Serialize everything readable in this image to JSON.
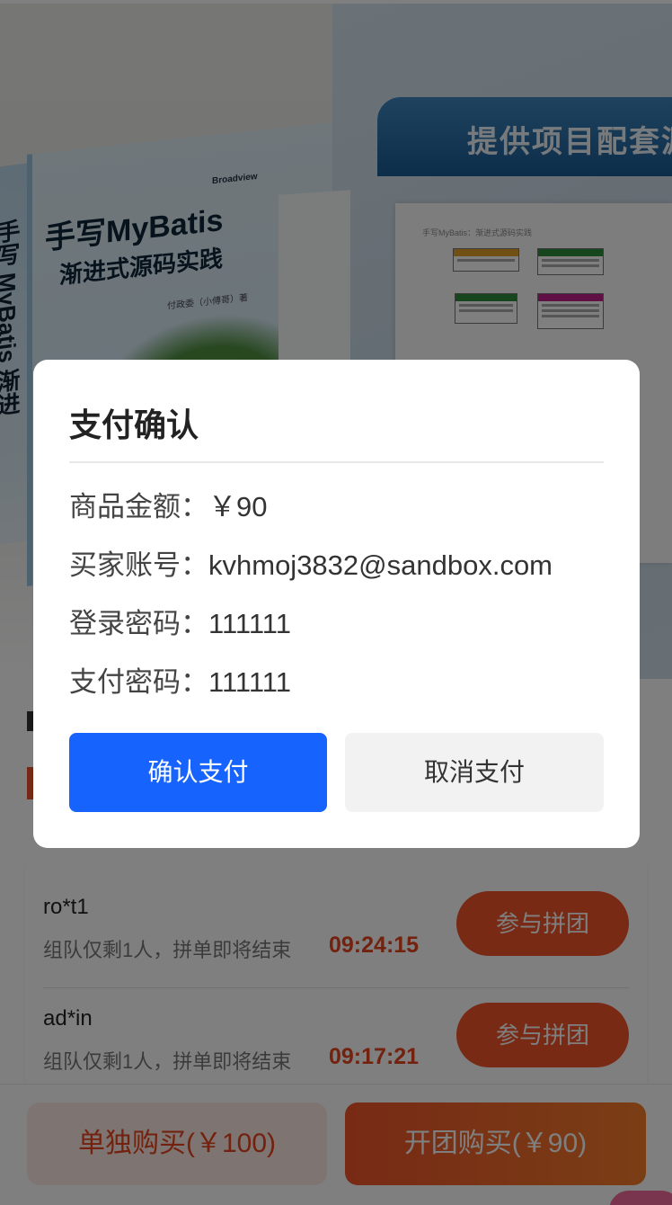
{
  "hero": {
    "book_title_line1": "手写MyBatis",
    "book_title_line2": "渐进式源码实践",
    "book_spine": "手写 MyBatis 渐进",
    "book_author": "付政委（小傅哥）著",
    "book_publisher": "Broadview",
    "banner_text": "提供项目配套源",
    "page_caption": "手写MyBatis：渐进式源码实践"
  },
  "groups": [
    {
      "user": "ro*t1",
      "tip": "组队仅剩1人，拼单即将结束",
      "timer": "09:24:15",
      "join_label": "参与拼团"
    },
    {
      "user": "ad*in",
      "tip": "组队仅剩1人，拼单即将结束",
      "timer": "09:17:21",
      "join_label": "参与拼团"
    }
  ],
  "bottom": {
    "single_label": "单独购买(￥100)",
    "group_label": "开团购买(￥90)"
  },
  "modal": {
    "title": "支付确认",
    "amount_label": "商品金额：",
    "amount_value": "￥90",
    "account_label": "买家账号：",
    "account_value": "kvhmoj3832@sandbox.com",
    "login_pwd_label": "登录密码：",
    "login_pwd_value": "111111",
    "pay_pwd_label": "支付密码：",
    "pay_pwd_value": "111111",
    "confirm_label": "确认支付",
    "cancel_label": "取消支付"
  },
  "colors": {
    "accent_blue": "#1763fe",
    "accent_orange": "#f0542a",
    "timer_red": "#e5451c"
  }
}
